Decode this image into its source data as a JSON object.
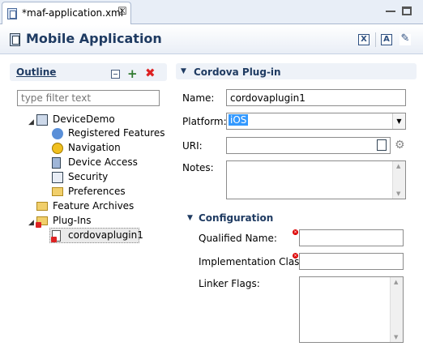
{
  "editor_tab": {
    "title": "*maf-application.xml",
    "close": "☒"
  },
  "header": {
    "title": "Mobile Application"
  },
  "outline": {
    "title": "Outline",
    "filter_placeholder": "type filter text",
    "tree": [
      {
        "label": "DeviceDemo",
        "icon": "application-icon"
      },
      {
        "label": "Registered Features",
        "icon": "features-icon"
      },
      {
        "label": "Navigation",
        "icon": "navigation-icon"
      },
      {
        "label": "Device Access",
        "icon": "device-access-icon"
      },
      {
        "label": "Security",
        "icon": "security-icon"
      },
      {
        "label": "Preferences",
        "icon": "folder-icon"
      },
      {
        "label": "Feature Archives",
        "icon": "folder-icon"
      },
      {
        "label": "Plug-Ins",
        "icon": "plugins-folder-icon"
      },
      {
        "label": "cordovaplugin1",
        "icon": "plugin-icon"
      }
    ]
  },
  "cordova": {
    "title": "Cordova Plug-in",
    "name_label": "Name:",
    "name_value": "cordovaplugin1",
    "platform_label": "Platform:",
    "platform_value": "iOS",
    "uri_label": "URI:",
    "uri_value": "",
    "notes_label": "Notes:",
    "notes_value": ""
  },
  "configuration": {
    "title": "Configuration",
    "qualified_label": "Qualified Name:",
    "qualified_value": "",
    "impl_label": "Implementation Class:",
    "impl_value": "",
    "linker_label": "Linker Flags:",
    "linker_value": ""
  }
}
